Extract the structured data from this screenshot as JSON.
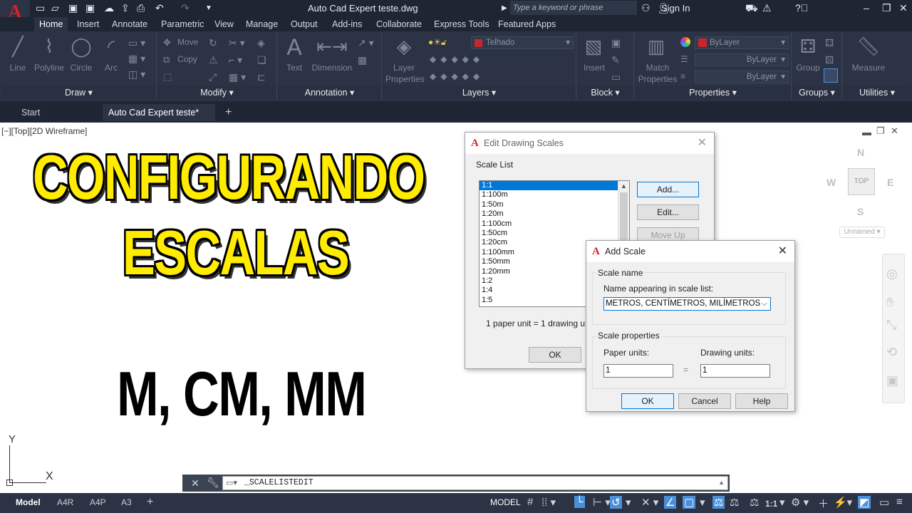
{
  "app": {
    "logo": "A",
    "document_title": "Auto Cad Expert teste.dwg",
    "search_placeholder": "Type a keyword or phrase",
    "sign_in": "Sign In"
  },
  "ribbon_tabs": [
    "Home",
    "Insert",
    "Annotate",
    "Parametric",
    "View",
    "Manage",
    "Output",
    "Add-ins",
    "Collaborate",
    "Express Tools",
    "Featured Apps"
  ],
  "panels": {
    "draw": {
      "title": "Draw",
      "tools": [
        "Line",
        "Polyline",
        "Circle",
        "Arc"
      ]
    },
    "modify": {
      "title": "Modify",
      "tools": [
        "Move",
        "Copy"
      ]
    },
    "annotation": {
      "title": "Annotation",
      "tools": [
        "Text",
        "Dimension"
      ]
    },
    "layers": {
      "title": "Layers",
      "tool": "Layer",
      "tool2": "Properties",
      "layer_name": "Telhado"
    },
    "block": {
      "title": "Block",
      "tool": "Insert"
    },
    "properties": {
      "title": "Properties",
      "tool": "Match",
      "tool2": "Properties",
      "color": "ByLayer",
      "linetype": "ByLayer",
      "lineweight": "ByLayer"
    },
    "groups": {
      "title": "Groups",
      "tool": "Group"
    },
    "utilities": {
      "title": "Utilities",
      "tool": "Measure"
    }
  },
  "doc_tabs": {
    "start": "Start",
    "active": "Auto Cad Expert teste*"
  },
  "viewport": {
    "label": "[−][Top][2D Wireframe]",
    "viewcube": {
      "n": "N",
      "s": "S",
      "e": "E",
      "w": "W",
      "top": "TOP",
      "ucs": "Unnamed"
    },
    "axis_y": "Y",
    "axis_x": "X"
  },
  "overlay": {
    "line1": "CONFIGURANDO",
    "line2": "ESCALAS",
    "line3": "M, CM, MM"
  },
  "edit_scales_dialog": {
    "title": "Edit Drawing Scales",
    "group_label": "Scale List",
    "scales": [
      "1:1",
      "1:100m",
      "1:50m",
      "1:20m",
      "1:100cm",
      "1:50cm",
      "1:20cm",
      "1:100mm",
      "1:50mm",
      "1:20mm",
      "1:2",
      "1:4",
      "1:5"
    ],
    "selected_index": 0,
    "buttons": {
      "add": "Add...",
      "edit": "Edit...",
      "move_up": "Move Up",
      "ok": "OK"
    },
    "footer": "1 paper unit = 1 drawing unit"
  },
  "add_scale_dialog": {
    "title": "Add Scale",
    "scale_name_group": "Scale name",
    "name_label": "Name appearing in scale list:",
    "name_value": "METROS, CENTÍMETROS, MILÍMETROS",
    "props_group": "Scale properties",
    "paper_label": "Paper units:",
    "drawing_label": "Drawing units:",
    "paper_value": "1",
    "drawing_value": "1",
    "equals": "=",
    "buttons": {
      "ok": "OK",
      "cancel": "Cancel",
      "help": "Help"
    }
  },
  "command_line": {
    "text": "_SCALELISTEDIT"
  },
  "status": {
    "layout_tabs": [
      "Model",
      "A4R",
      "A4P",
      "A3"
    ],
    "model_label": "MODEL",
    "scale": "1:1"
  },
  "colors": {
    "accent": "#0078d7",
    "brand": "#d81e2a",
    "headline": "#ffec00",
    "chrome": "#2b3344"
  }
}
